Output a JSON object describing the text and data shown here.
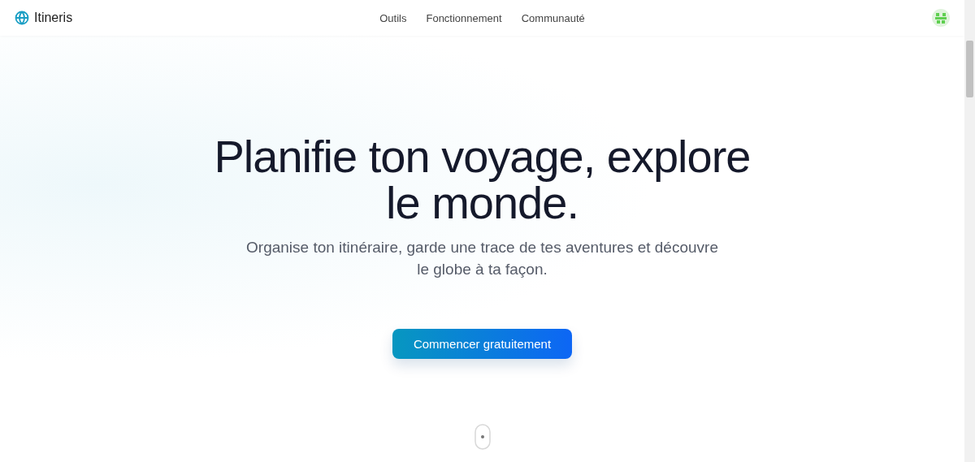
{
  "header": {
    "logo": "Itineris",
    "nav": [
      {
        "label": "Outils"
      },
      {
        "label": "Fonctionnement"
      },
      {
        "label": "Communauté"
      }
    ]
  },
  "hero": {
    "title_lines": [
      "Planifie ton voyage, explore",
      "le monde."
    ],
    "subtitle_lines": [
      "Organise ton itinéraire, garde une trace de tes aventures et découvre",
      "le globe à ta façon."
    ],
    "cta": "Commencer gratuitement"
  }
}
